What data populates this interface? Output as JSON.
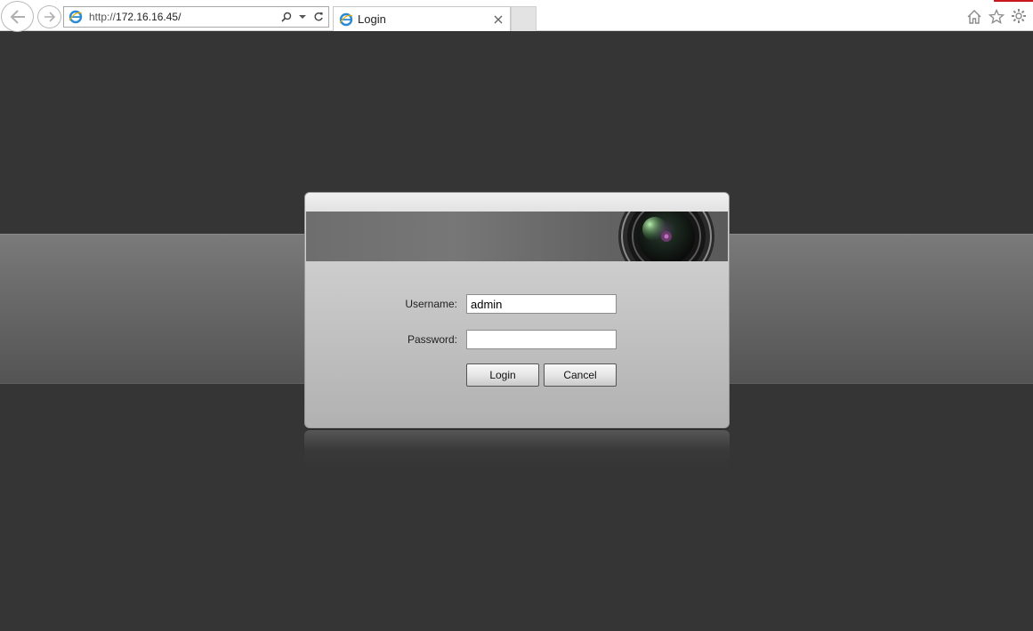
{
  "browser": {
    "address": {
      "protocol": "http://",
      "host": "172.16.16.45/"
    },
    "tab": {
      "title": "Login"
    }
  },
  "login": {
    "username_label": "Username:",
    "username_value": "admin",
    "password_label": "Password:",
    "password_value": "",
    "login_button": "Login",
    "cancel_button": "Cancel"
  },
  "colors": {
    "page_background": "#353535",
    "band": "#6a6a6a",
    "browser_accent": "#c8171d",
    "ie_logo": "#2b8ad6"
  },
  "icons": {
    "back": "back-arrow-icon",
    "forward": "forward-arrow-icon",
    "site": "internet-explorer-icon",
    "search": "search-icon",
    "dropdown": "chevron-down-icon",
    "refresh": "refresh-icon",
    "close_tab": "close-icon",
    "home": "home-icon",
    "favorites": "star-icon",
    "settings": "gear-icon",
    "banner": "camera-lens-icon"
  }
}
